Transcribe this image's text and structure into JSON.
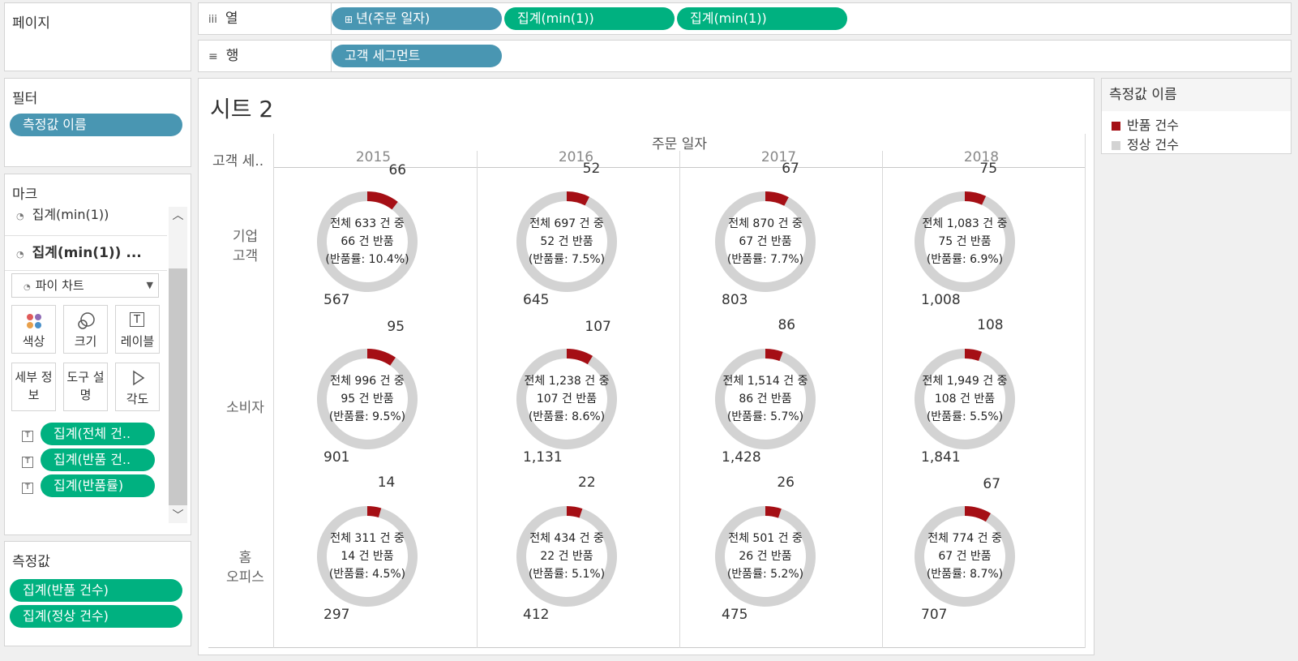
{
  "pages_panel": {
    "title": "페이지"
  },
  "columns_shelf": {
    "label": "열",
    "icon": "columns-icon",
    "pills": [
      "년(주문 일자)",
      "집계(min(1))",
      "집계(min(1))"
    ]
  },
  "rows_shelf": {
    "label": "행",
    "icon": "rows-icon",
    "pills": [
      "고객 세그먼트"
    ]
  },
  "filters_panel": {
    "title": "필터",
    "pills": [
      "측정값 이름"
    ]
  },
  "marks_panel": {
    "title": "마크",
    "layers": [
      "집계(min(1))",
      "집계(min(1)) ..."
    ],
    "mark_type": "파이 차트",
    "cards": [
      "색상",
      "크기",
      "레이블",
      "세부 정보",
      "도구 설명",
      "각도"
    ],
    "label_pills": [
      "집계(전체 건..",
      "집계(반품 건..",
      "집계(반품률)"
    ]
  },
  "measures_panel": {
    "title": "측정값",
    "pills": [
      "집계(반품 건수)",
      "집계(정상 건수)"
    ]
  },
  "sheet": {
    "title": "시트 2",
    "column_header": "주문 일자",
    "row_field": "고객 세.."
  },
  "legend": {
    "title": "측정값 이름",
    "items": [
      {
        "label": "반품 건수",
        "color": "#a50f15"
      },
      {
        "label": "정상 건수",
        "color": "#d3d3d3"
      }
    ]
  },
  "chart_data": {
    "type": "pie",
    "donut": true,
    "columns": [
      "2015",
      "2016",
      "2017",
      "2018"
    ],
    "rows": [
      "기업 고객",
      "소비자",
      "홈 오피스"
    ],
    "series": [
      {
        "name": "반품 건수",
        "color": "#a50f15"
      },
      {
        "name": "정상 건수",
        "color": "#d3d3d3"
      }
    ],
    "cells": [
      [
        {
          "returns": 66,
          "normal": 567,
          "text": [
            "전체 633 건 중",
            "66 건 반품",
            "(반품률: 10.4%)"
          ],
          "returns_label": "66",
          "normal_label": "567"
        },
        {
          "returns": 52,
          "normal": 645,
          "text": [
            "전체 697 건 중",
            "52 건 반품",
            "(반품률: 7.5%)"
          ],
          "returns_label": "52",
          "normal_label": "645"
        },
        {
          "returns": 67,
          "normal": 803,
          "text": [
            "전체 870 건 중",
            "67 건 반품",
            "(반품률: 7.7%)"
          ],
          "returns_label": "67",
          "normal_label": "803"
        },
        {
          "returns": 75,
          "normal": 1008,
          "text": [
            "전체 1,083 건 중",
            "75 건 반품",
            "(반품률: 6.9%)"
          ],
          "returns_label": "75",
          "normal_label": "1,008"
        }
      ],
      [
        {
          "returns": 95,
          "normal": 901,
          "text": [
            "전체 996 건 중",
            "95 건 반품",
            "(반품률: 9.5%)"
          ],
          "returns_label": "95",
          "normal_label": "901"
        },
        {
          "returns": 107,
          "normal": 1131,
          "text": [
            "전체 1,238 건 중",
            "107 건 반품",
            "(반품률: 8.6%)"
          ],
          "returns_label": "107",
          "normal_label": "1,131"
        },
        {
          "returns": 86,
          "normal": 1428,
          "text": [
            "전체 1,514 건 중",
            "86 건 반품",
            "(반품률: 5.7%)"
          ],
          "returns_label": "86",
          "normal_label": "1,428"
        },
        {
          "returns": 108,
          "normal": 1841,
          "text": [
            "전체 1,949 건 중",
            "108 건 반품",
            "(반품률: 5.5%)"
          ],
          "returns_label": "108",
          "normal_label": "1,841"
        }
      ],
      [
        {
          "returns": 14,
          "normal": 297,
          "text": [
            "전체 311 건 중",
            "14 건 반품",
            "(반품률: 4.5%)"
          ],
          "returns_label": "14",
          "normal_label": "297"
        },
        {
          "returns": 22,
          "normal": 412,
          "text": [
            "전체 434 건 중",
            "22 건 반품",
            "(반품률: 5.1%)"
          ],
          "returns_label": "22",
          "normal_label": "412"
        },
        {
          "returns": 26,
          "normal": 475,
          "text": [
            "전체 501 건 중",
            "26 건 반품",
            "(반품률: 5.2%)"
          ],
          "returns_label": "26",
          "normal_label": "475"
        },
        {
          "returns": 67,
          "normal": 707,
          "text": [
            "전체 774 건 중",
            "67 건 반품",
            "(반품률: 8.7%)"
          ],
          "returns_label": "67",
          "normal_label": "707"
        }
      ]
    ]
  }
}
